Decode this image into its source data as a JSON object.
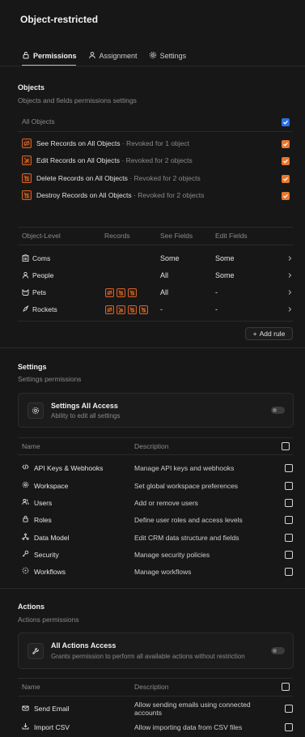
{
  "page": {
    "title": "Object-restricted"
  },
  "tabs": [
    {
      "label": "Permissions",
      "active": true
    },
    {
      "label": "Assignment",
      "active": false
    },
    {
      "label": "Settings",
      "active": false
    }
  ],
  "objects": {
    "title": "Objects",
    "subtitle": "Objects and fields permissions settings",
    "all_label": "All Objects",
    "permissions": [
      {
        "label": "See Records on All Objects",
        "note": "· Revoked for 1 object"
      },
      {
        "label": "Edit Records on All Objects",
        "note": "· Revoked for 2 objects"
      },
      {
        "label": "Delete Records on All Objects",
        "note": "· Revoked for 2 objects"
      },
      {
        "label": "Destroy Records on All Objects",
        "note": "· Revoked for 2 objects"
      }
    ],
    "table_headers": [
      "Object-Level",
      "Records",
      "See Fields",
      "Edit Fields"
    ],
    "rows": [
      {
        "name": "Coms",
        "icon": "building-icon",
        "records": 0,
        "see": "Some",
        "edit": "Some"
      },
      {
        "name": "People",
        "icon": "user-icon",
        "records": 0,
        "see": "All",
        "edit": "Some"
      },
      {
        "name": "Pets",
        "icon": "cat-icon",
        "records": 3,
        "see": "All",
        "edit": "-"
      },
      {
        "name": "Rockets",
        "icon": "rocket-icon",
        "records": 4,
        "see": "-",
        "edit": "-"
      }
    ],
    "add_rule_label": "Add rule"
  },
  "settings": {
    "title": "Settings",
    "subtitle": "Settings permissions",
    "card_title": "Settings All Access",
    "card_sub": "Ability to edit all settings",
    "headers": {
      "name": "Name",
      "description": "Description"
    },
    "items": [
      {
        "name": "API Keys & Webhooks",
        "icon": "code-icon",
        "description": "Manage API keys and webhooks"
      },
      {
        "name": "Workspace",
        "icon": "gear-icon",
        "description": "Set global workspace preferences"
      },
      {
        "name": "Users",
        "icon": "users-icon",
        "description": "Add or remove users"
      },
      {
        "name": "Roles",
        "icon": "lock-icon",
        "description": "Define user roles and access levels"
      },
      {
        "name": "Data Model",
        "icon": "hierarchy-icon",
        "description": "Edit CRM data structure and fields"
      },
      {
        "name": "Security",
        "icon": "key-icon",
        "description": "Manage security policies"
      },
      {
        "name": "Workflows",
        "icon": "settings-automation-icon",
        "description": "Manage workflows"
      }
    ]
  },
  "actions": {
    "title": "Actions",
    "subtitle": "Actions permissions",
    "card_title": "All Actions Access",
    "card_sub": "Grants permission to perform all available actions without restriction",
    "headers": {
      "name": "Name",
      "description": "Description"
    },
    "items": [
      {
        "name": "Send Email",
        "icon": "mail-icon",
        "description_line1": "Allow sending emails using connected",
        "description_line2": "accounts"
      },
      {
        "name": "Import CSV",
        "icon": "import-icon",
        "description_line1": "Allow importing data from CSV files",
        "description_line2": ""
      }
    ]
  },
  "colors": {
    "background": "#171717",
    "accent_orange": "#e8772e",
    "accent_blue": "#2b6fe6"
  }
}
